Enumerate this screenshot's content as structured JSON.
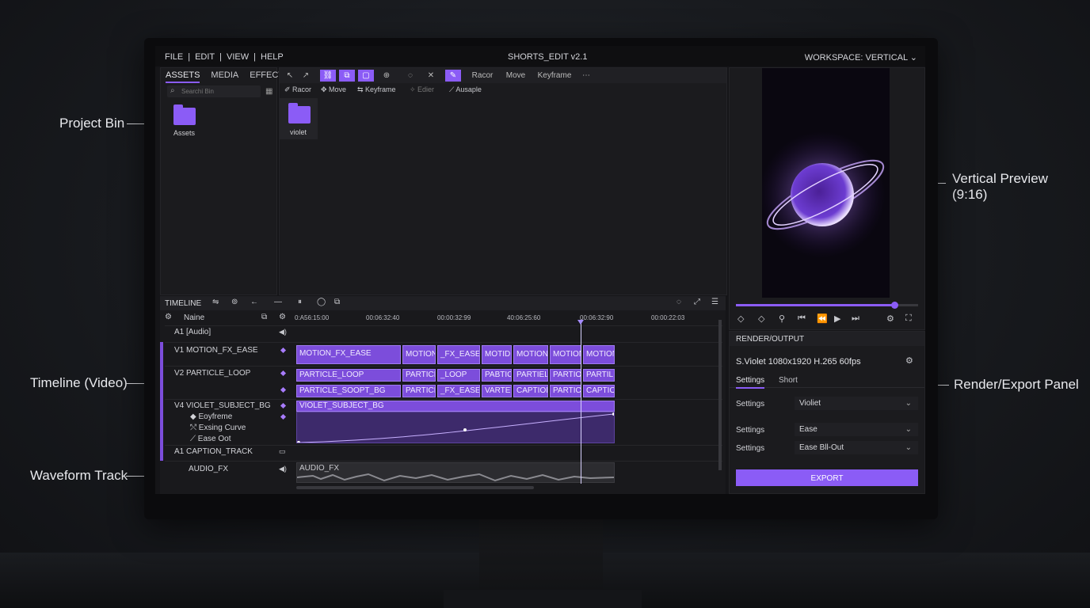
{
  "menu": [
    "FILE",
    "EDIT",
    "VIEW",
    "HELP"
  ],
  "app_title": "SHORTS_EDIT v2.1",
  "workspace": "WORKSPACE: VERTICAL",
  "bin": {
    "tabs": [
      "ASSETS",
      "MEDIA",
      "EFFECTS"
    ],
    "search_placeholder": "Searchi Bin",
    "folder": "Assets"
  },
  "viewer": {
    "tools": [
      "Racor",
      "Move",
      "Keyframe"
    ],
    "subtools": [
      "Racor",
      "Move",
      "Keyframe",
      "Edier",
      "Ausaple"
    ],
    "folder": "violet"
  },
  "timeline": {
    "label": "TIMELINE",
    "name_header": "Naine",
    "timecodes": [
      "0:A56:15:00",
      "00:06:32:40",
      "00:00:32:99",
      "40:06:25:60",
      "00:06:32:90",
      "00:00:22:03"
    ],
    "tracks": [
      "A1 [Audio]",
      "V1 MOTION_FX_EASE",
      "V2 PARTICLE_LOOP",
      "V4 VIOLET_SUBJECT_BG",
      "Eoyfreme",
      "Exsing Curve",
      "Ease Oot",
      "A1 CAPTION_TRACK",
      "AUDIO_FX"
    ],
    "clips": {
      "v1": [
        "MOTION_FX_EASE",
        "MOTION",
        "_FX_EASE..",
        "MOTIDI",
        "MOTION",
        "MOTION",
        "MOTION"
      ],
      "v2a": [
        "PARTICLE_LOOP",
        "PARTICL",
        "_LOOP",
        "PABTIC",
        "PARTIEL",
        "PARTIOL",
        "PARTIL"
      ],
      "v2b": [
        "PARTICLE_SOOPT_BG",
        "PARTICR",
        "_FX_EASE",
        "VARTET",
        "CAPTION",
        "PARTICL",
        "CAPTIO"
      ],
      "v4": "VIOLET_SUBJECT_BG",
      "audio": "AUDIO_FX"
    }
  },
  "render": {
    "title": "RENDER/OUTPUT",
    "preset": "S.Violet 1080x1920 H.265 60fps",
    "tabs": [
      "Settings",
      "Short"
    ],
    "rows": [
      {
        "label": "Settings",
        "value": "Violiet"
      },
      {
        "label": "Settings",
        "value": "Ease"
      },
      {
        "label": "Settings",
        "value": "Ease Bll-Out"
      }
    ],
    "export": "EXPORT"
  },
  "preview": {
    "progress": 0.87
  },
  "callouts": {
    "bin": "Project Bin",
    "timeline": "Timeline (Video)",
    "waveform": "Waveform Track",
    "preview": "Vertical Preview",
    "preview_ratio": "(9:16)",
    "render": "Render/Export Panel"
  },
  "colors": {
    "accent": "#8b5cf6"
  }
}
